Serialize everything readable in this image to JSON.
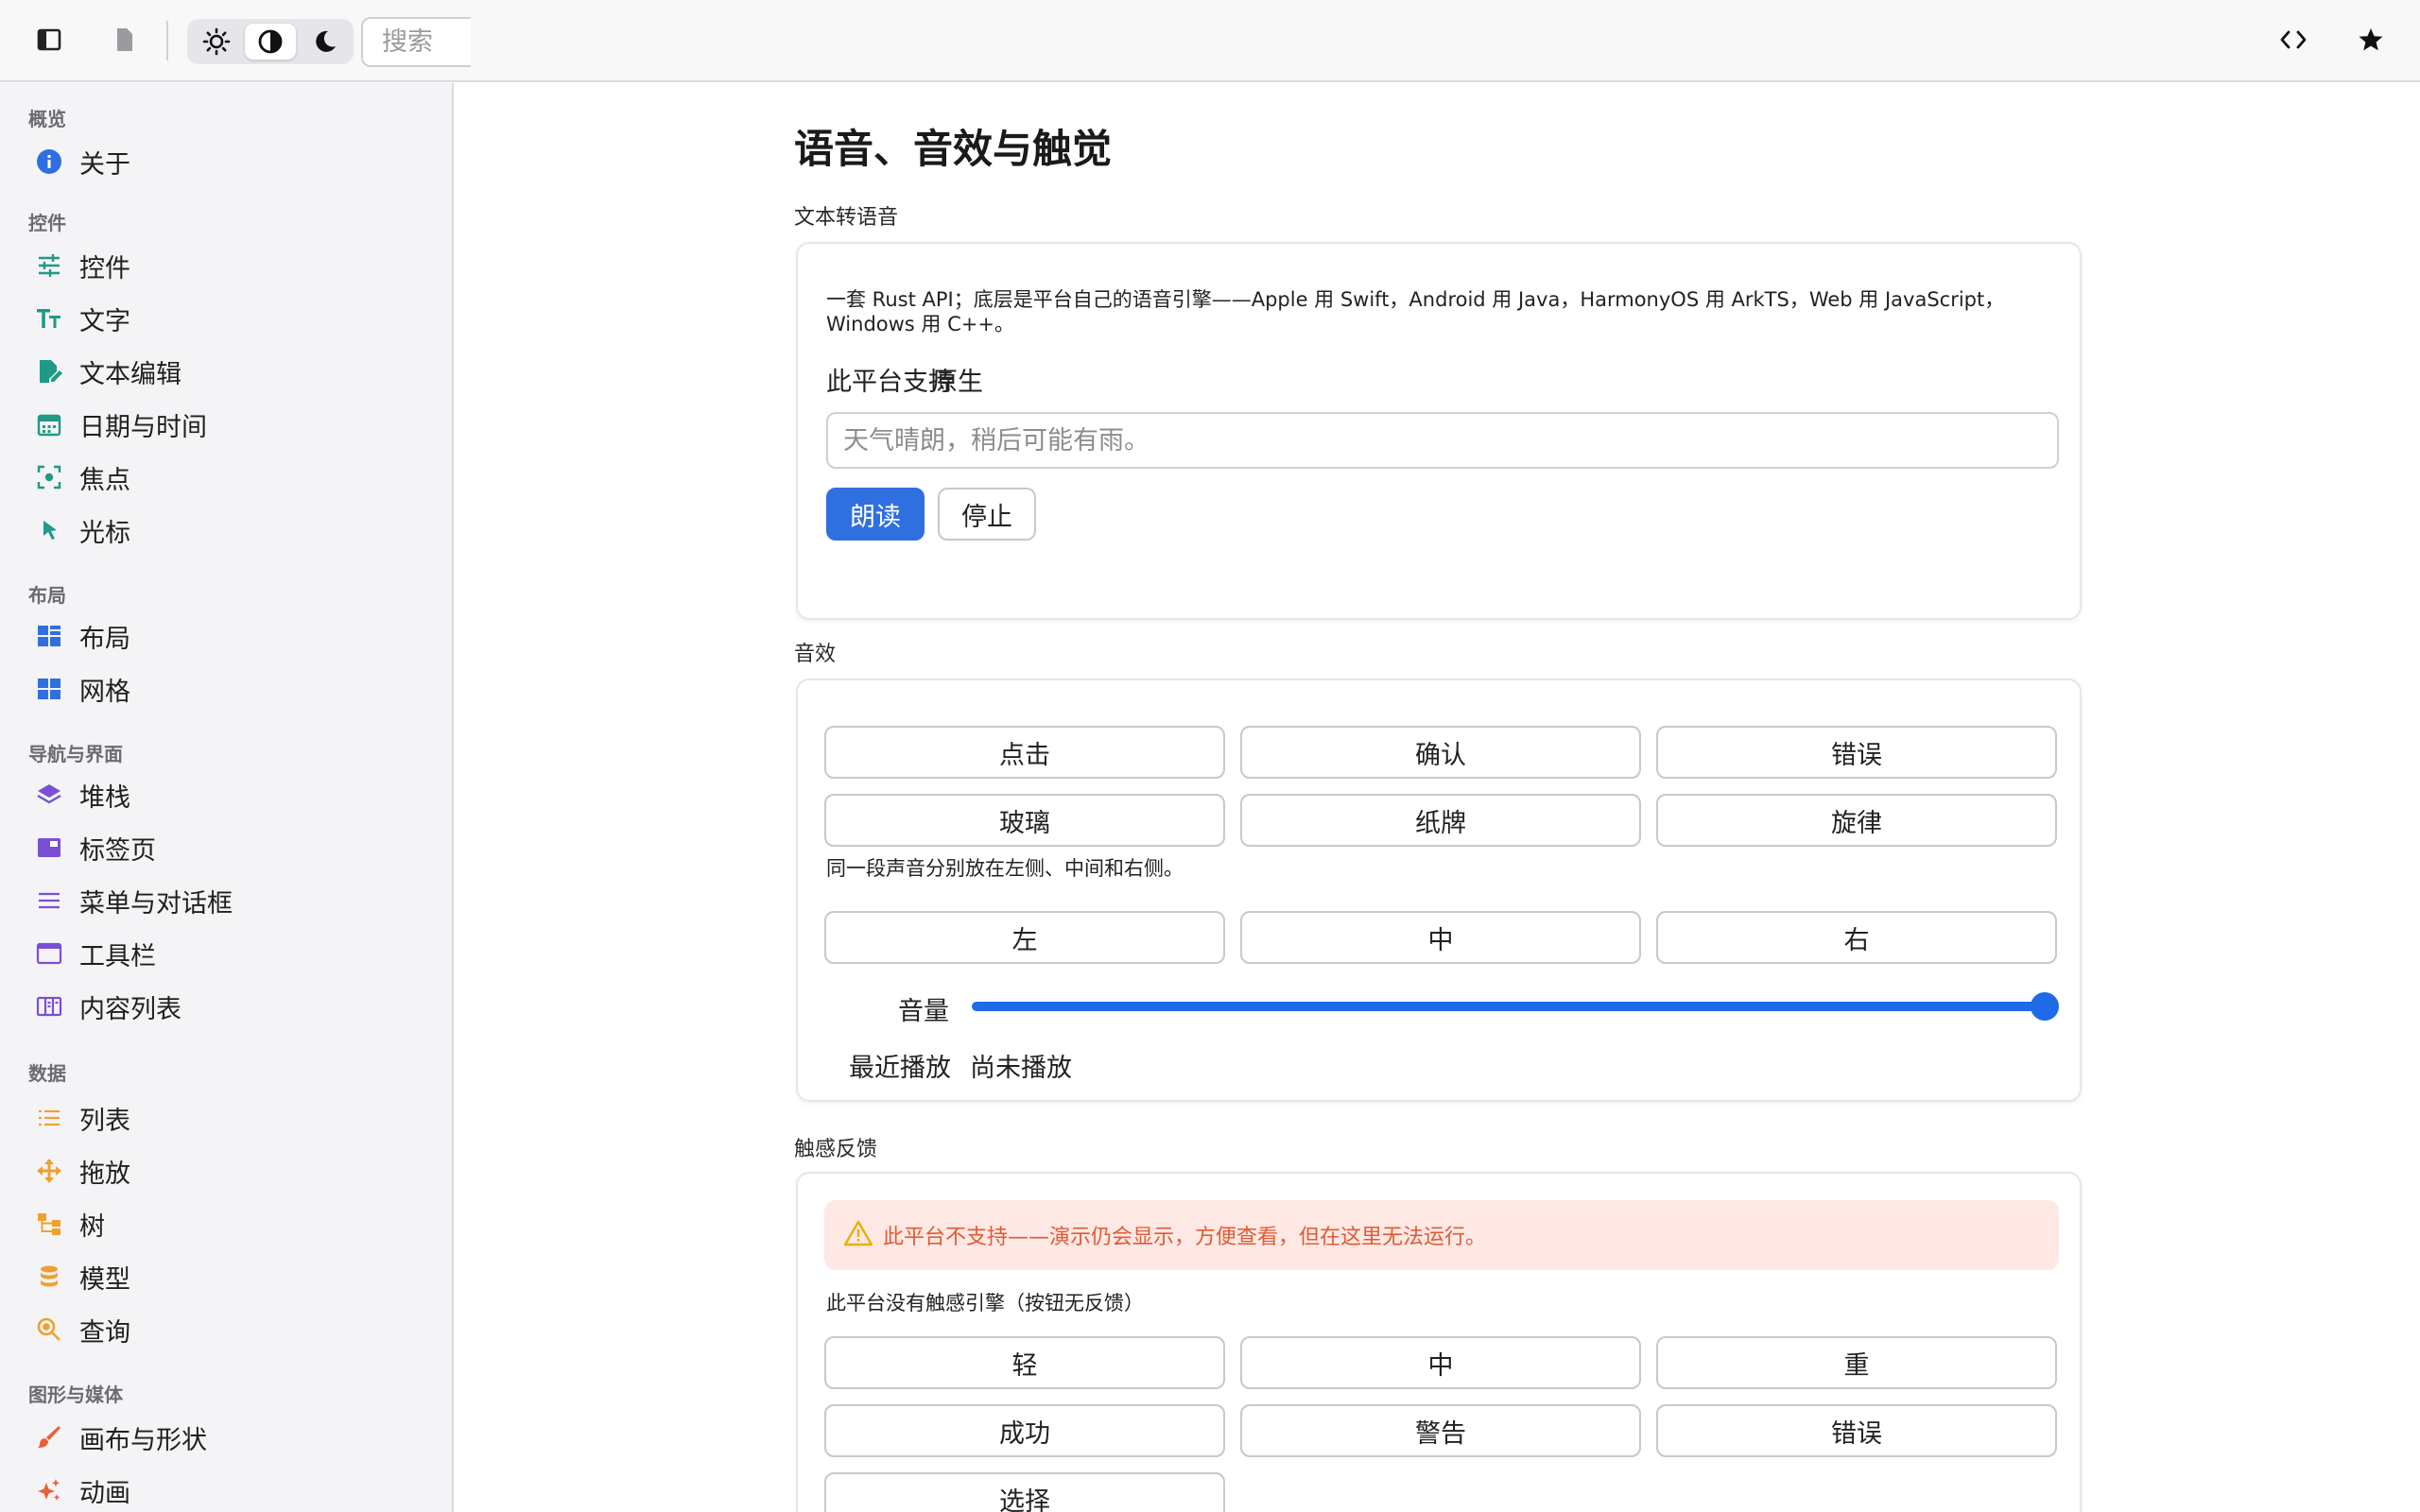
{
  "toolbar": {
    "search_placeholder": "搜索",
    "icons": [
      "sidebar-toggle-icon",
      "document-icon",
      "sun-icon",
      "contrast-icon",
      "moon-icon",
      "code-icon",
      "star-icon"
    ],
    "theme_selected": "contrast"
  },
  "sidebar": {
    "sections": [
      {
        "title": "概览",
        "items": [
          {
            "label": "关于",
            "icon": "info-icon",
            "color": "#2f6fe0"
          }
        ]
      },
      {
        "title": "控件",
        "items": [
          {
            "label": "控件",
            "icon": "sliders-icon",
            "color": "#1e9a86"
          },
          {
            "label": "文字",
            "icon": "text-size-icon",
            "color": "#1e9a86"
          },
          {
            "label": "文本编辑",
            "icon": "edit-document-icon",
            "color": "#1e9a86"
          },
          {
            "label": "日期与时间",
            "icon": "calendar-icon",
            "color": "#1e9a86"
          },
          {
            "label": "焦点",
            "icon": "focus-icon",
            "color": "#1e9a86"
          },
          {
            "label": "光标",
            "icon": "cursor-icon",
            "color": "#1e9a86"
          }
        ]
      },
      {
        "title": "布局",
        "items": [
          {
            "label": "布局",
            "icon": "layout-icon",
            "color": "#2f6fe0"
          },
          {
            "label": "网格",
            "icon": "grid-icon",
            "color": "#2f6fe0"
          }
        ]
      },
      {
        "title": "导航与界面",
        "items": [
          {
            "label": "堆栈",
            "icon": "layers-icon",
            "color": "#7a4fd6"
          },
          {
            "label": "标签页",
            "icon": "tabs-icon",
            "color": "#7a4fd6"
          },
          {
            "label": "菜单与对话框",
            "icon": "menu-icon",
            "color": "#7a4fd6"
          },
          {
            "label": "工具栏",
            "icon": "window-icon",
            "color": "#7a4fd6"
          },
          {
            "label": "内容列表",
            "icon": "columns-icon",
            "color": "#7a4fd6"
          }
        ]
      },
      {
        "title": "数据",
        "items": [
          {
            "label": "列表",
            "icon": "list-icon",
            "color": "#f0a030"
          },
          {
            "label": "拖放",
            "icon": "move-icon",
            "color": "#f0a030"
          },
          {
            "label": "树",
            "icon": "tree-icon",
            "color": "#f0a030"
          },
          {
            "label": "模型",
            "icon": "database-icon",
            "color": "#f0a030"
          },
          {
            "label": "查询",
            "icon": "search-zoom-icon",
            "color": "#f0a030"
          }
        ]
      },
      {
        "title": "图形与媒体",
        "items": [
          {
            "label": "画布与形状",
            "icon": "brush-icon",
            "color": "#e8613a"
          },
          {
            "label": "动画",
            "icon": "sparkle-icon",
            "color": "#e8613a"
          }
        ]
      }
    ]
  },
  "main": {
    "title": "语音、音效与触觉",
    "tts": {
      "label": "文本转语音",
      "description": "一套 Rust API；底层是平台自己的语音引擎——Apple 用 Swift，Android 用 Java，HarmonyOS 用 ArkTS，Web 用 JavaScript，Windows 用 C++。",
      "support_label": "此平台支持",
      "support_value": "原生",
      "input_placeholder": "天气晴朗，稍后可能有雨。",
      "speak_button": "朗读",
      "stop_button": "停止"
    },
    "sfx": {
      "label": "音效",
      "buttons": [
        "点击",
        "确认",
        "错误",
        "玻璃",
        "纸牌",
        "旋律"
      ],
      "pan_note": "同一段声音分别放在左侧、中间和右侧。",
      "pan_buttons": [
        "左",
        "中",
        "右"
      ],
      "volume_label": "音量",
      "volume_value": 1.0,
      "recent_label": "最近播放",
      "recent_value": "尚未播放"
    },
    "haptics": {
      "label": "触感反馈",
      "warning": "此平台不支持——演示仍会显示，方便查看，但在这里无法运行。",
      "note": "此平台没有触感引擎（按钮无反馈）",
      "buttons": [
        "轻",
        "中",
        "重",
        "成功",
        "警告",
        "错误",
        "选择"
      ]
    }
  },
  "colors": {
    "accent": "#2f6fe0",
    "slider": "#1f6ae8",
    "warning_bg": "#fde8e3",
    "warning_text": "#e05a35",
    "warning_icon": "#e8b000"
  }
}
